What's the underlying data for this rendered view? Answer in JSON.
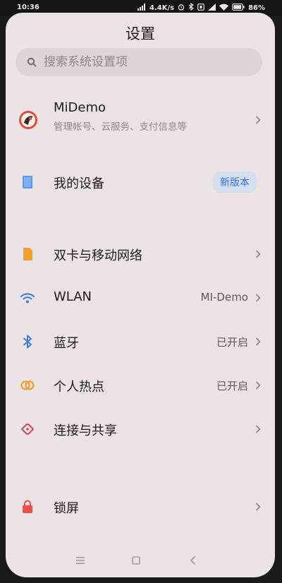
{
  "status_bar": {
    "time": "10:36",
    "net_speed": "4.4K/s",
    "battery": "86%"
  },
  "page": {
    "title": "设置"
  },
  "search": {
    "placeholder": "搜索系统设置项"
  },
  "account": {
    "name": "MiDemo",
    "description": "管理帐号、云服务、支付信息等"
  },
  "device": {
    "label": "我的设备",
    "badge": "新版本"
  },
  "settings": [
    {
      "label": "双卡与移动网络",
      "value": "",
      "icon": "sim-card-icon",
      "color": "#f1a02a"
    },
    {
      "label": "WLAN",
      "value": "MI-Demo",
      "icon": "wifi-icon",
      "color": "#3a7ed9"
    },
    {
      "label": "蓝牙",
      "value": "已开启",
      "icon": "bluetooth-icon",
      "color": "#3a7ed9"
    },
    {
      "label": "个人热点",
      "value": "已开启",
      "icon": "hotspot-icon",
      "color": "#f1a02a"
    },
    {
      "label": "连接与共享",
      "value": "",
      "icon": "connection-sharing-icon",
      "color": "#e24b5a"
    },
    {
      "label": "锁屏",
      "value": "",
      "icon": "lock-icon",
      "color": "#f05048"
    }
  ],
  "navigation": {
    "icons": [
      "menu-icon",
      "home-icon",
      "back-icon"
    ]
  }
}
